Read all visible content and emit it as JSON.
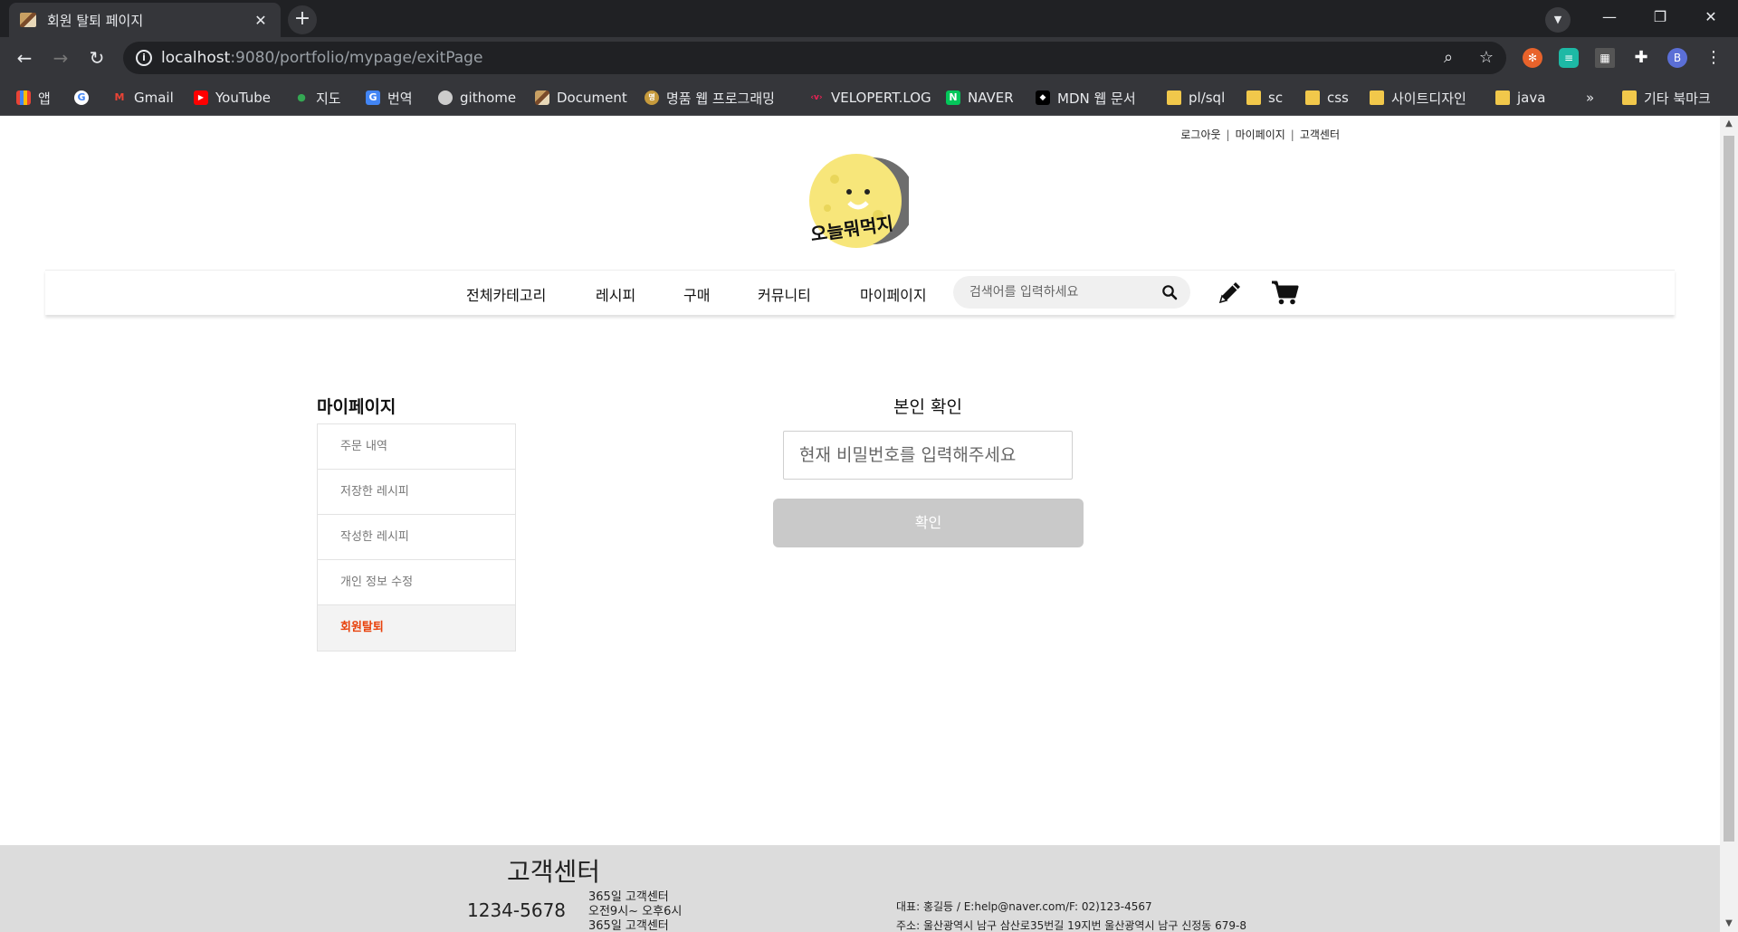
{
  "browser": {
    "tab_title": "회원 탈퇴 페이지",
    "url_host": "localhost",
    "url_path": ":9080/portfolio/mypage/exitPage",
    "profile_initial": "B",
    "bookmarks": [
      {
        "label": "앱",
        "icon": "apps-grid-icon"
      },
      {
        "label": "",
        "icon": "google-icon"
      },
      {
        "label": "Gmail",
        "icon": "gmail-icon"
      },
      {
        "label": "YouTube",
        "icon": "youtube-icon"
      },
      {
        "label": "지도",
        "icon": "maps-icon"
      },
      {
        "label": "번역",
        "icon": "translate-icon"
      },
      {
        "label": "githome",
        "icon": "globe-icon"
      },
      {
        "label": "Document",
        "icon": "document-icon"
      },
      {
        "label": "명품 웹 프로그래밍",
        "icon": "site-icon"
      },
      {
        "label": "VELOPERT.LOG",
        "icon": "velopert-icon"
      },
      {
        "label": "NAVER",
        "icon": "naver-icon"
      },
      {
        "label": "MDN 웹 문서",
        "icon": "mdn-icon"
      },
      {
        "label": "pl/sql",
        "icon": "folder-icon"
      },
      {
        "label": "sc",
        "icon": "folder-icon"
      },
      {
        "label": "css",
        "icon": "folder-icon"
      },
      {
        "label": "사이트디자인",
        "icon": "folder-icon"
      },
      {
        "label": "java",
        "icon": "folder-icon"
      }
    ],
    "bookmarks_overflow": "»",
    "other_bookmarks": "기타 북마크"
  },
  "page": {
    "util_links": [
      "로그아웃",
      "마이페이지",
      "고객센터"
    ],
    "logo_text": "오늘뭐먹지",
    "nav": [
      "전체카테고리",
      "레시피",
      "구매",
      "커뮤니티",
      "마이페이지"
    ],
    "search_placeholder": "검색어를 입력하세요",
    "sidebar_title": "마이페이지",
    "sidebar_items": [
      "주문 내역",
      "저장한 레시피",
      "작성한 레시피",
      "개인 정보 수정",
      "회원탈퇴"
    ],
    "verify_title": "본인 확인",
    "password_placeholder": "현재 비밀번호를 입력해주세요",
    "confirm_label": "확인"
  },
  "footer": {
    "title": "고객센터",
    "phone": "1234-5678",
    "hours": [
      "365일 고객센터",
      "오전9시~ 오후6시",
      "365일 고객센터"
    ],
    "contact": "대표: 홍길등 / E:help@naver.com/F: 02)123-4567",
    "address": "주소: 울산광역시 남구 삼산로35번길 19지번 울산광역시 남구 신정동 679-8"
  },
  "colors": {
    "active_menu": "#e8410b",
    "confirm_button": "#c9c9c9",
    "footer_bg": "#dcdcdc"
  }
}
